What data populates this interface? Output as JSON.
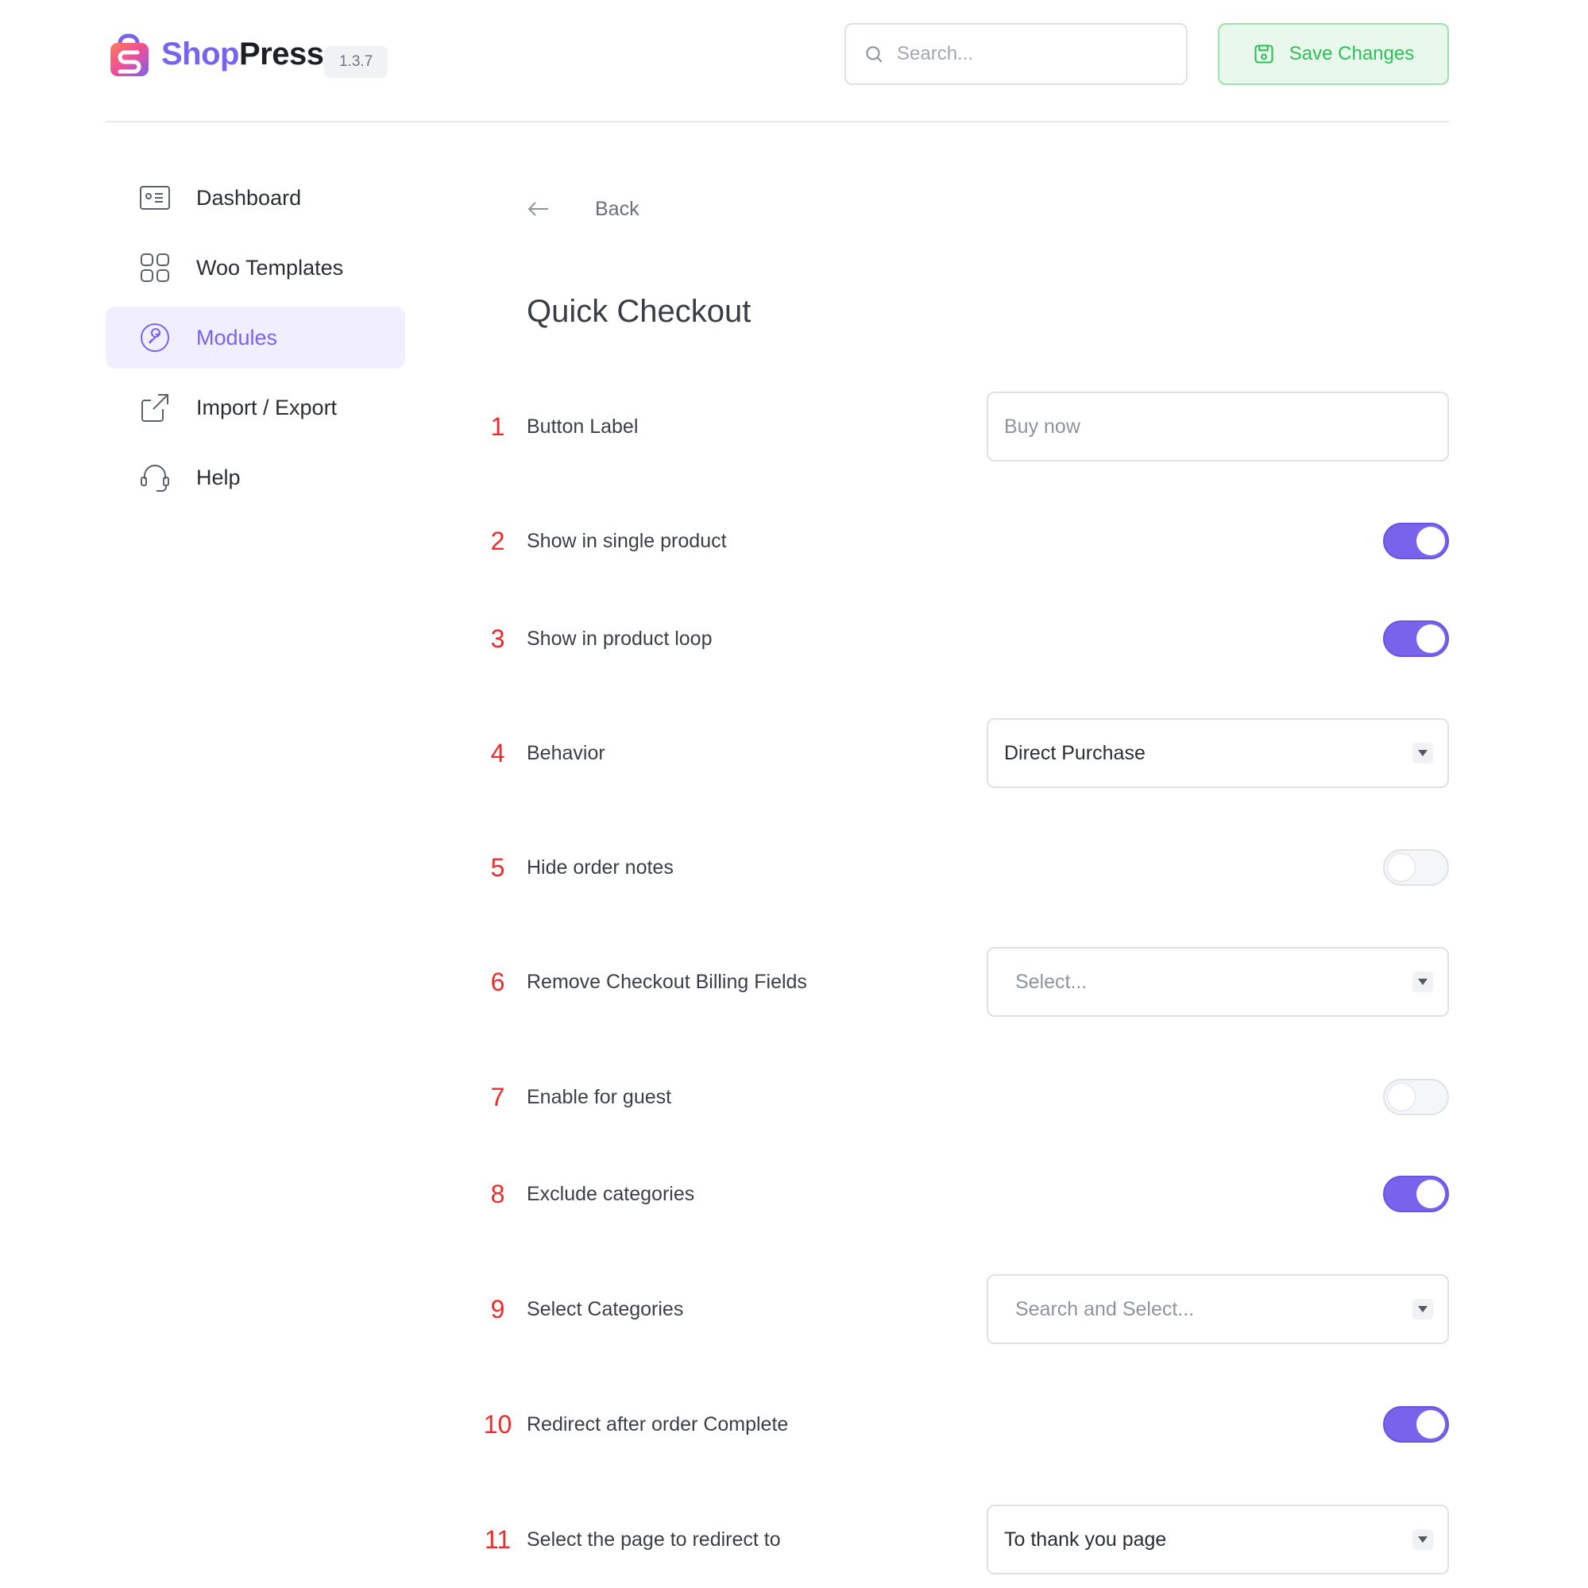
{
  "header": {
    "brand_shop": "Shop",
    "brand_press": "Press",
    "version": "1.3.7",
    "search_placeholder": "Search...",
    "save_label": "Save Changes"
  },
  "sidebar": {
    "items": [
      {
        "label": "Dashboard",
        "icon": "dashboard-icon",
        "active": false
      },
      {
        "label": "Woo Templates",
        "icon": "grid-icon",
        "active": false
      },
      {
        "label": "Modules",
        "icon": "modules-icon",
        "active": true
      },
      {
        "label": "Import / Export",
        "icon": "export-icon",
        "active": false
      },
      {
        "label": "Help",
        "icon": "headset-icon",
        "active": false
      }
    ]
  },
  "main": {
    "back_label": "Back",
    "title": "Quick Checkout",
    "rows": [
      {
        "num": "1",
        "label": "Button Label",
        "type": "input",
        "placeholder": "Buy now"
      },
      {
        "num": "2",
        "label": "Show in single product",
        "type": "toggle",
        "on": true
      },
      {
        "num": "3",
        "label": "Show in product loop",
        "type": "toggle",
        "on": true
      },
      {
        "num": "4",
        "label": "Behavior",
        "type": "select",
        "value": "Direct Purchase"
      },
      {
        "num": "5",
        "label": "Hide order notes",
        "type": "toggle",
        "on": false
      },
      {
        "num": "6",
        "label": "Remove Checkout Billing Fields",
        "type": "select",
        "placeholder": "Select..."
      },
      {
        "num": "7",
        "label": "Enable for guest",
        "type": "toggle",
        "on": false
      },
      {
        "num": "8",
        "label": "Exclude categories",
        "type": "toggle",
        "on": true
      },
      {
        "num": "9",
        "label": "Select Categories",
        "type": "select",
        "placeholder": "Search and Select..."
      },
      {
        "num": "10",
        "label": "Redirect after order Complete",
        "type": "toggle",
        "on": true
      },
      {
        "num": "11",
        "label": "Select the page to redirect to",
        "type": "select",
        "value": "To thank you page"
      }
    ]
  },
  "colors": {
    "accent": "#7a63ec",
    "save_green": "#2dbf57",
    "row_number_red": "#ee2a2a"
  }
}
